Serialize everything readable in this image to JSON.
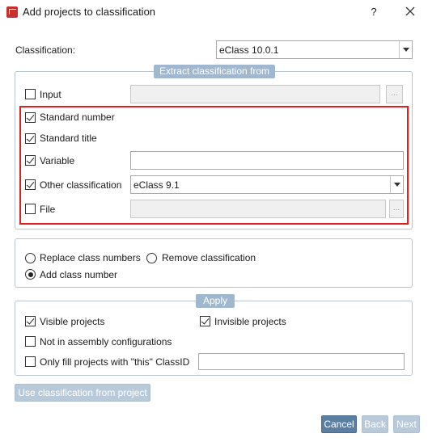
{
  "window": {
    "title": "Add projects to classification",
    "help_label": "?"
  },
  "classification": {
    "label": "Classification:",
    "value": "eClass 10.0.1"
  },
  "extract_group": {
    "title": "Extract classification from",
    "input": {
      "label": "Input",
      "checked": false,
      "browse_label": "..."
    },
    "standard_number": {
      "label": "Standard number",
      "checked": true
    },
    "standard_title": {
      "label": "Standard title",
      "checked": true
    },
    "variable": {
      "label": "Variable",
      "checked": true,
      "value": ""
    },
    "other_classification": {
      "label": "Other classification",
      "checked": true,
      "value": "eClass 9.1"
    },
    "file": {
      "label": "File",
      "checked": false,
      "browse_label": "..."
    }
  },
  "mode_group": {
    "replace": {
      "label": "Replace class numbers",
      "selected": false
    },
    "remove": {
      "label": "Remove classification",
      "selected": false
    },
    "add": {
      "label": "Add class number",
      "selected": true
    }
  },
  "apply_group": {
    "title": "Apply",
    "visible": {
      "label": "Visible projects",
      "checked": true
    },
    "invisible": {
      "label": "Invisible projects",
      "checked": true
    },
    "not_in_assembly": {
      "label": "Not in assembly configurations",
      "checked": false
    },
    "only_fill": {
      "label": "Only fill projects with \"this\" ClassID",
      "checked": false,
      "value": ""
    }
  },
  "buttons": {
    "use_from_project": "Use classification from project",
    "cancel": "Cancel",
    "back": "Back",
    "next": "Next"
  },
  "colors": {
    "group_title_bg": "#9fb8cf",
    "highlight_border": "#e02020",
    "primary_button": "#5b7fa3",
    "disabled_button": "#b8c9da",
    "app_icon": "#c8302c"
  }
}
